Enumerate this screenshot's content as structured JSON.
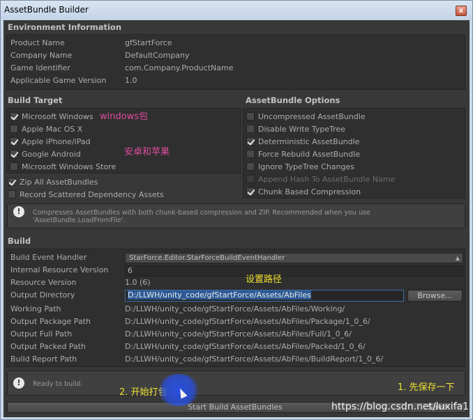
{
  "window": {
    "title": "AssetBundle Builder",
    "close": "x"
  },
  "environment": {
    "title": "Environment Information",
    "rows": [
      {
        "label": "Product Name",
        "value": "gfStartForce"
      },
      {
        "label": "Company Name",
        "value": "DefaultCompany"
      },
      {
        "label": "Game Identifier",
        "value": "com.Company.ProductName"
      },
      {
        "label": "Applicable Game Version",
        "value": "1.0"
      }
    ]
  },
  "build_target": {
    "title": "Build Target",
    "items": [
      {
        "label": "Microsoft Windows",
        "checked": true
      },
      {
        "label": "Apple Mac OS X",
        "checked": false
      },
      {
        "label": "Apple iPhone/iPad",
        "checked": true
      },
      {
        "label": "Google Android",
        "checked": true
      },
      {
        "label": "Microsoft Windows Store",
        "checked": false
      }
    ],
    "zip_all": {
      "label": "Zip All AssetBundles",
      "checked": true
    },
    "record_scattered": {
      "label": "Record Scattered Dependency Assets",
      "checked": false
    }
  },
  "assetbundle_options": {
    "title": "AssetBundle Options",
    "items": [
      {
        "label": "Uncompressed AssetBundle",
        "checked": false,
        "disabled": false
      },
      {
        "label": "Disable Write TypeTree",
        "checked": false,
        "disabled": false
      },
      {
        "label": "Deterministic AssetBundle",
        "checked": true,
        "disabled": false
      },
      {
        "label": "Force Rebuild AssetBundle",
        "checked": false,
        "disabled": false
      },
      {
        "label": "Ignore TypeTree Changes",
        "checked": false,
        "disabled": false
      },
      {
        "label": "Append Hash To AssetBundle Name",
        "checked": false,
        "disabled": true
      },
      {
        "label": "Chunk Based Compression",
        "checked": true,
        "disabled": false
      }
    ]
  },
  "info_message": {
    "icon": "info-icon",
    "text_line1": "Compresses AssetBundles with both chunk-based compression and ZIP. Recommended when you use",
    "text_line2": "'AssetBundle.LoadFromFile'."
  },
  "build": {
    "title": "Build",
    "build_event_handler": {
      "label": "Build Event Handler",
      "value": "StarForce.Editor.StarForceBuildEventHandler"
    },
    "internal_resource_version": {
      "label": "Internal Resource Version",
      "value": "6"
    },
    "resource_version": {
      "label": "Resource Version",
      "value": "1.0 (6)"
    },
    "output_directory": {
      "label": "Output Directory",
      "value": "D:/LLWH/unity_code/gfStartForce/Assets/AbFiles",
      "browse": "Browse..."
    },
    "paths": [
      {
        "label": "Working Path",
        "value": "D:/LLWH/unity_code/gfStartForce/Assets/AbFiles/Working/"
      },
      {
        "label": "Output Package Path",
        "value": "D:/LLWH/unity_code/gfStartForce/Assets/AbFiles/Package/1_0_6/"
      },
      {
        "label": "Output Full Path",
        "value": "D:/LLWH/unity_code/gfStartForce/Assets/AbFiles/Full/1_0_6/"
      },
      {
        "label": "Output Packed Path",
        "value": "D:/LLWH/unity_code/gfStartForce/Assets/AbFiles/Packed/1_0_6/"
      },
      {
        "label": "Build Report Path",
        "value": "D:/LLWH/unity_code/gfStartForce/Assets/AbFiles/BuildReport/1_0_6/"
      }
    ]
  },
  "status": {
    "text": "Ready to build."
  },
  "footer": {
    "start_build": "Start Build AssetBundles",
    "save_partial": "Save"
  },
  "annotations": {
    "windows": "windows包",
    "android_apple": "安卓和苹果",
    "set_path": "设置路径",
    "start_pack": "2. 开始打包",
    "save_first": "1. 先保存一下"
  },
  "watermark": "https://blog.csdn.net/luxifa1"
}
